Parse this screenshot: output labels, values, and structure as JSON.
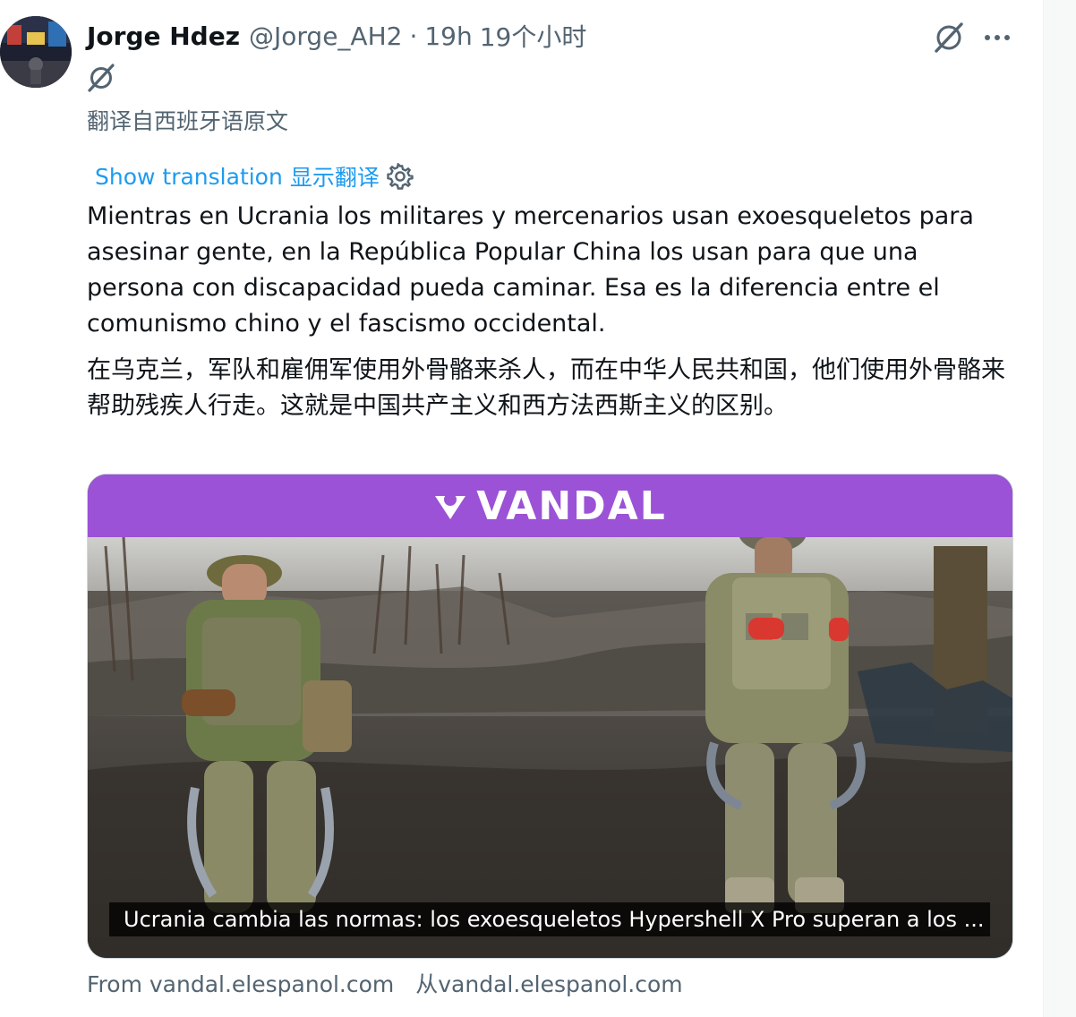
{
  "author": {
    "display_name": "Jorge Hdez",
    "handle": "@Jorge_AH2",
    "separator": "·",
    "time": "19h",
    "time_translated": "19个小时"
  },
  "translated_from": "翻译自西班牙语原文",
  "translation": {
    "show_label": "Show translation",
    "show_label_cn": "显示翻译",
    "settings_icon": "gear-icon"
  },
  "tweet": {
    "text": "Mientras en Ucrania los militares y mercenarios usan exoesqueletos para asesinar gente, en la República Popular China los usan para que una persona con discapacidad pueda caminar. Esa es la diferencia entre el comunismo chino y el fascismo occidental.",
    "text_translated": "在乌克兰，军队和雇佣军使用外骨骼来杀人，而在中华人民共和国，他们使用外骨骼来帮助残疾人行走。这就是中国共产主义和西方法西斯主义的区别。"
  },
  "media": {
    "brand": "VANDAL",
    "caption": "Ucrania cambia las normas: los exoesqueletos Hypershell X Pro superan a los ..."
  },
  "source": {
    "label": "From vandal.elespanol.com",
    "label_cn": "从vandal.elespanol.com"
  },
  "icons": {
    "grok": "grok-icon",
    "more": "more-options-icon"
  },
  "colors": {
    "accent": "#1d9bf0",
    "secondary_text": "#536471",
    "vandal_purple": "#9b52d6"
  }
}
